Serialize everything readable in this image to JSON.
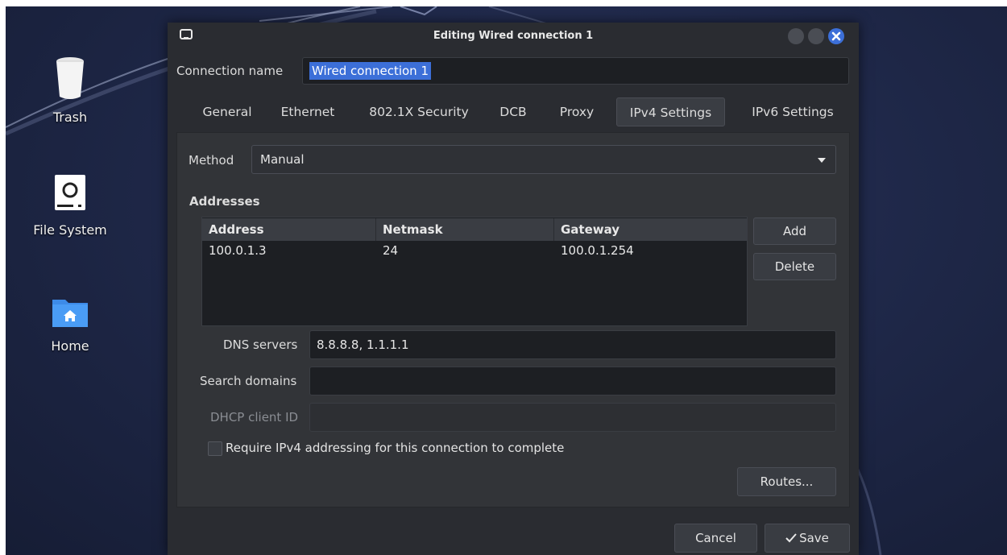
{
  "desktop": {
    "icons": [
      {
        "label": "Trash",
        "icon": "trash-icon"
      },
      {
        "label": "File System",
        "icon": "drive-icon"
      },
      {
        "label": "Home",
        "icon": "home-folder-icon"
      }
    ]
  },
  "window": {
    "title": "Editing Wired connection 1",
    "connection_name_label": "Connection name",
    "connection_name_value": "Wired connection 1",
    "tabs": [
      "General",
      "Ethernet",
      "802.1X Security",
      "DCB",
      "Proxy",
      "IPv4 Settings",
      "IPv6 Settings"
    ],
    "active_tab": "IPv4 Settings",
    "accent_color": "#3c6fd8"
  },
  "ipv4": {
    "method_label": "Method",
    "method_value": "Manual",
    "addresses_heading": "Addresses",
    "columns": [
      "Address",
      "Netmask",
      "Gateway"
    ],
    "rows": [
      {
        "address": "100.0.1.3",
        "netmask": "24",
        "gateway": "100.0.1.254"
      }
    ],
    "add_label": "Add",
    "delete_label": "Delete",
    "dns_label": "DNS servers",
    "dns_value": "8.8.8.8, 1.1.1.1",
    "search_domains_label": "Search domains",
    "search_domains_value": "",
    "dhcp_label": "DHCP client ID",
    "dhcp_value": "",
    "require_label": "Require IPv4 addressing for this connection to complete",
    "routes_label": "Routes..."
  },
  "footer": {
    "cancel_label": "Cancel",
    "save_label": "Save"
  }
}
